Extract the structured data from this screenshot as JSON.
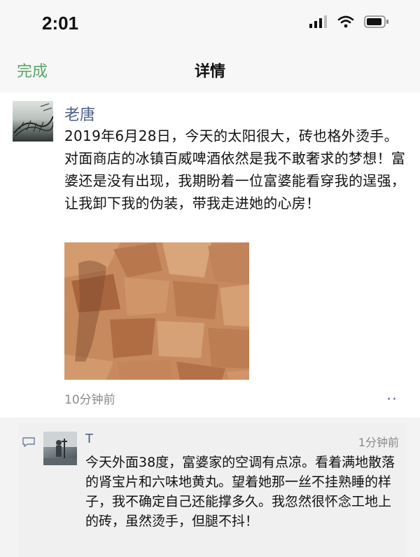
{
  "status_bar": {
    "time": "2:01"
  },
  "nav": {
    "back_label": "完成",
    "title": "详情"
  },
  "post": {
    "author": "老唐",
    "text": "2019年6月28日，今天的太阳很大，砖也格外烫手。对面商店的冰镇百威啤酒依然是我不敢奢求的梦想！富婆还是没有出现，我期盼着一位富婆能看穿我的逞强，让我卸下我的伪装，带我走进她的心房！",
    "time": "10分钟前"
  },
  "comment": {
    "author": "T",
    "time": "1分钟前",
    "text": "今天外面38度，富婆家的空调有点凉。看着满地散落的肾宝片和六味地黄丸。望着她那一丝不挂熟睡的样子，我不确定自己还能撑多久。我忽然很怀念工地上的砖，虽然烫手，但腿不抖！"
  }
}
